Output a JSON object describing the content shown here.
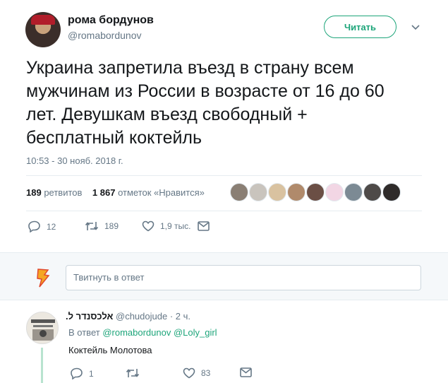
{
  "author": {
    "name": "рома бордунов",
    "handle": "@romabordunov"
  },
  "follow_label": "Читать",
  "tweet": {
    "text": "Украина запретила въезд в страну всем\nмужчинам из России в возрасте от 16 до 60\nлет. Девушкам въезд свободный +\nбесплатный коктейль",
    "timestamp": "10:53 - 30 нояб. 2018 г."
  },
  "stats": {
    "retweets_count": "189",
    "retweets_label": "ретвитов",
    "likes_count": "1 867",
    "likes_label": "отметок «Нравится»"
  },
  "actions": {
    "reply_count": "12",
    "retweet_count": "189",
    "like_count": "1,9 тыс."
  },
  "reply_box": {
    "placeholder": "Твитнуть в ответ"
  },
  "reply": {
    "name": "אלכסנדר ל.",
    "handle": "@chudojude",
    "time": "· 2 ч.",
    "in_reply_prefix": "В ответ",
    "in_reply_users": "@romabordunov @Loly_girl",
    "text": "Коктейль Молотова",
    "reply_count": "1",
    "retweet_count": "",
    "like_count": "83"
  },
  "colors": {
    "accent": "#1da57a",
    "muted": "#657786",
    "like_icon": "#657786"
  },
  "icons": {
    "reply": "reply-icon",
    "retweet": "retweet-icon",
    "like": "heart-icon",
    "dm": "envelope-icon",
    "caret": "chevron-down-icon",
    "compose": "lightning-icon"
  }
}
